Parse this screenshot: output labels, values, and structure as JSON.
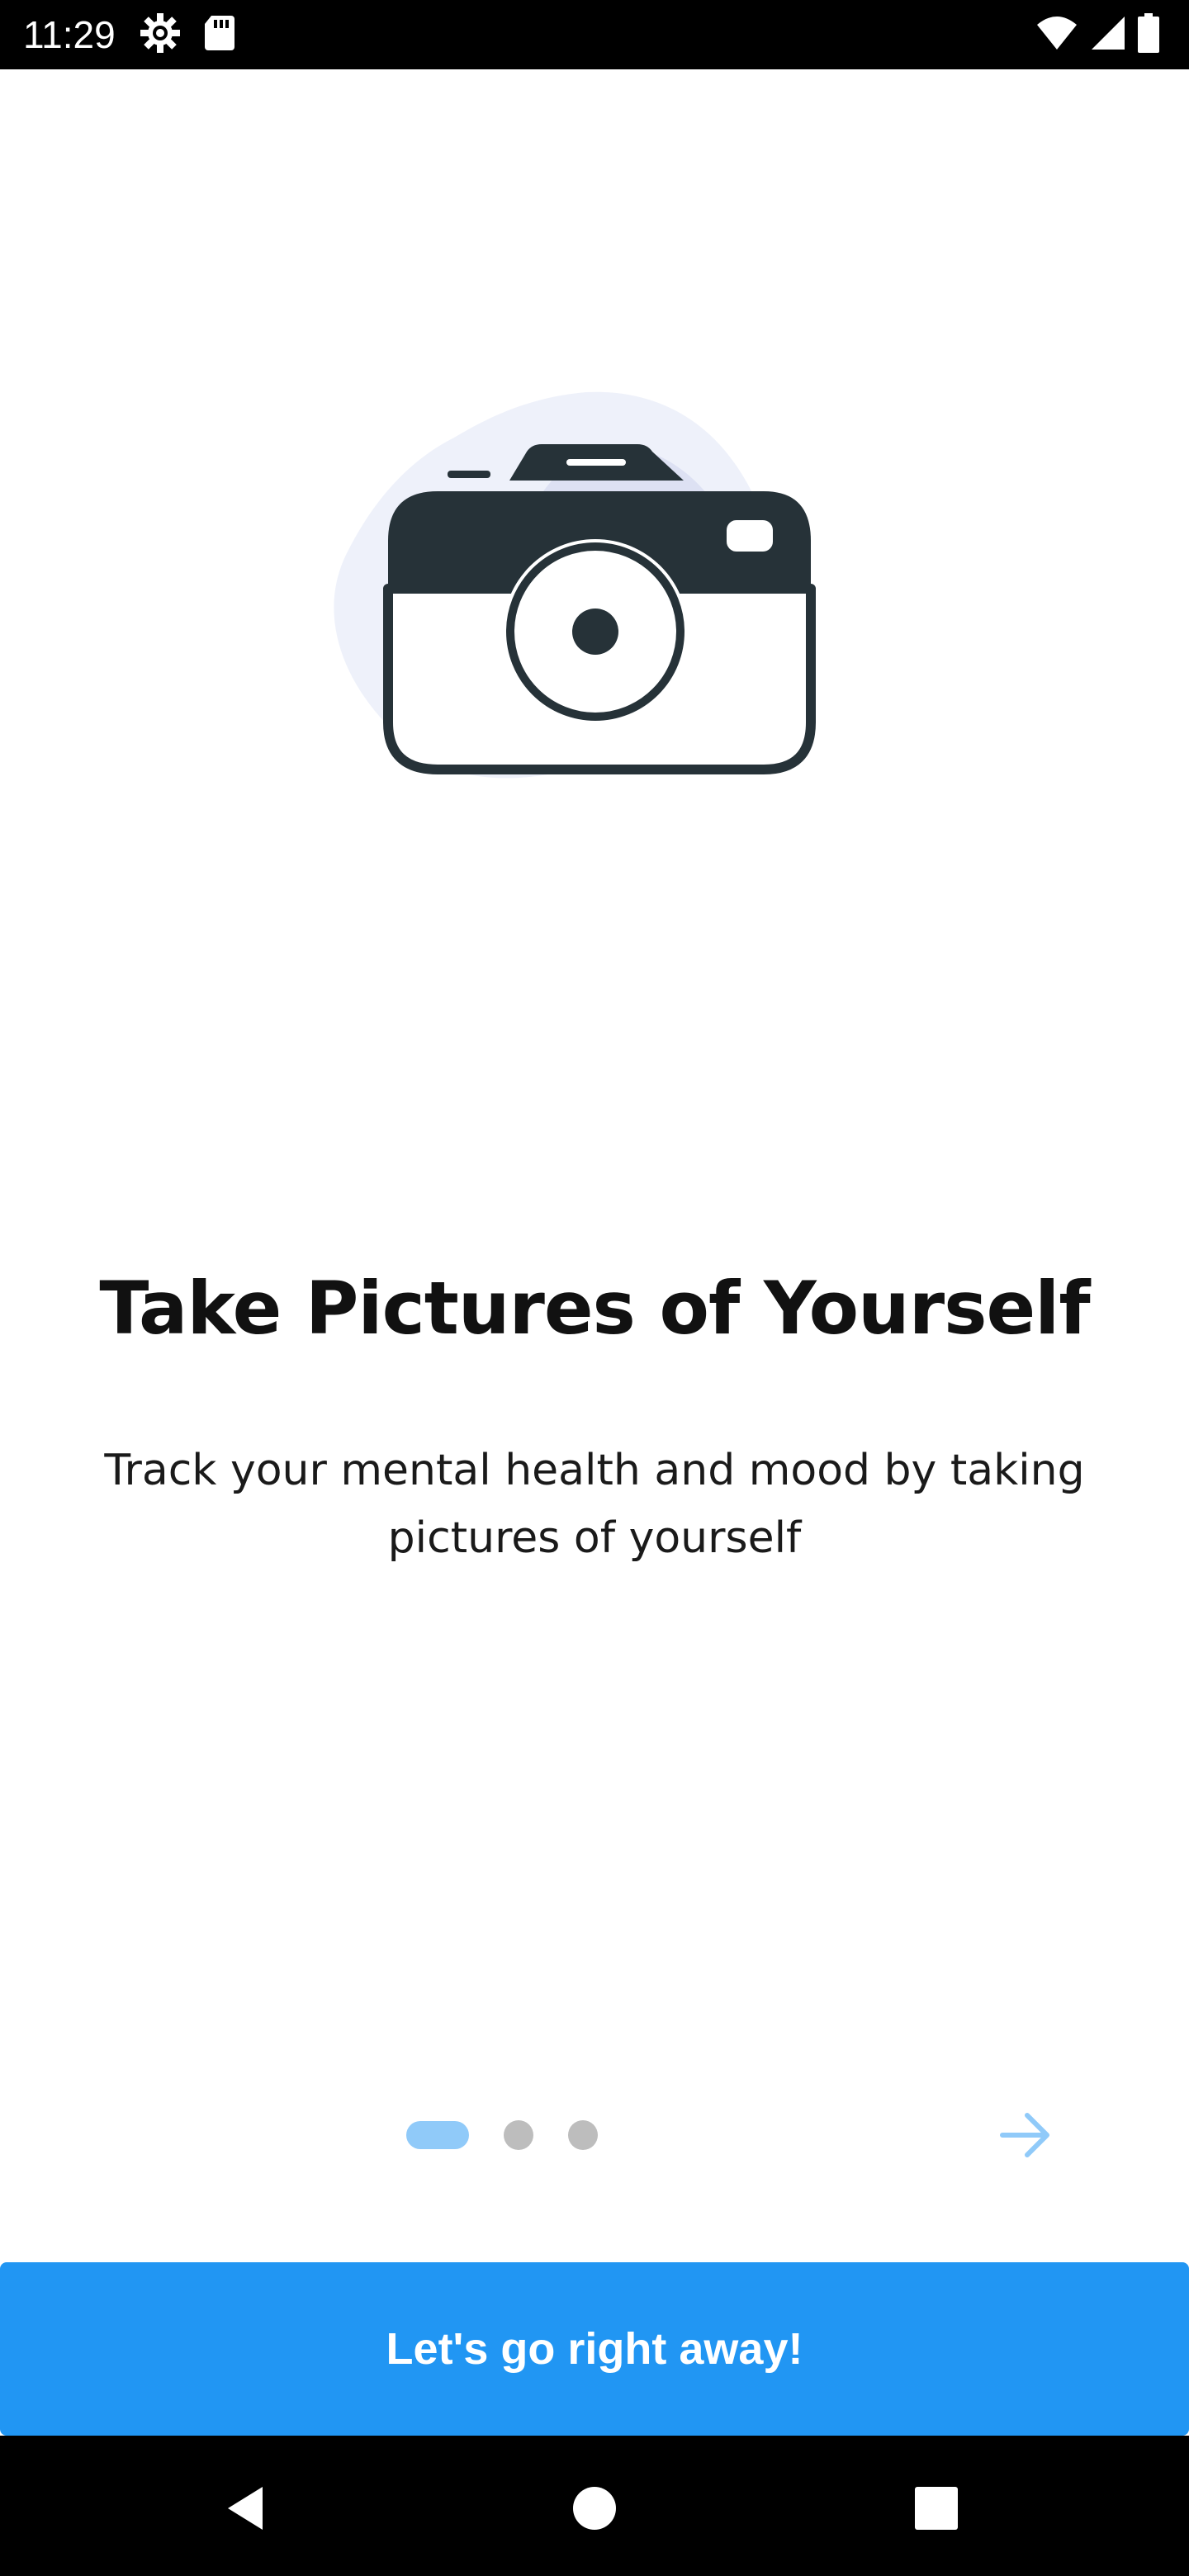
{
  "status_bar": {
    "time": "11:29",
    "left_icons": [
      "settings-gear-icon",
      "sd-card-icon"
    ],
    "right_icons": [
      "wifi-icon",
      "cell-signal-icon",
      "battery-icon"
    ]
  },
  "onboarding": {
    "illustration": "camera-icon",
    "title": "Take Pictures of Yourself",
    "description": "Track your mental health and mood by taking pictures of yourself",
    "pager": {
      "total_pages": 3,
      "current_page": 1
    },
    "next_icon": "arrow-right-icon"
  },
  "cta": {
    "label": "Let's go right away!"
  },
  "nav_bar": {
    "buttons": [
      "back-icon",
      "home-icon",
      "recents-icon"
    ]
  },
  "colors": {
    "accent": "#2196F3",
    "pager_active": "#90CAF9",
    "pager_inactive": "#BDBDBD",
    "camera_dark": "#263238",
    "blob_light": "#EEF1FA",
    "blob_mid": "#DDE1F3"
  }
}
